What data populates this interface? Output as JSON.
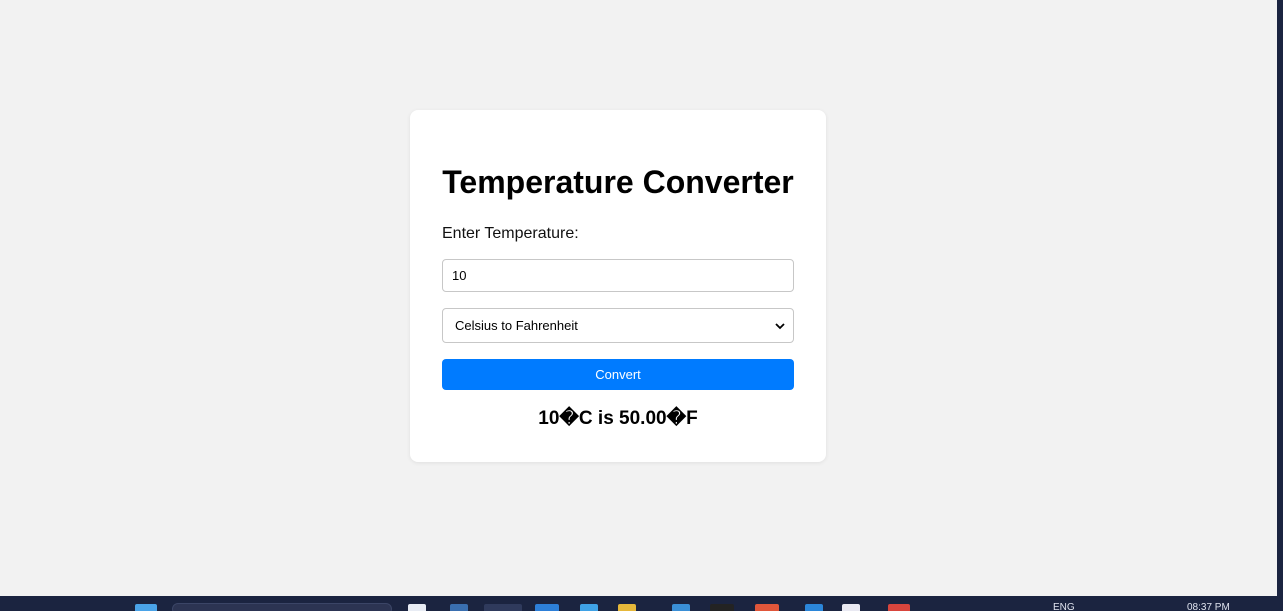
{
  "card": {
    "title": "Temperature Converter",
    "input_label": "Enter Temperature:",
    "input_value": "10",
    "select_value": "Celsius to Fahrenheit",
    "convert_label": "Convert",
    "result_text": "10�C is 50.00�F"
  },
  "colors": {
    "page_bg": "#f2f2f2",
    "card_bg": "#ffffff",
    "button_bg": "#007bff",
    "taskbar_bg": "#1b2440"
  },
  "taskbar": {
    "language": "ENG",
    "clock": "08:37 PM"
  }
}
